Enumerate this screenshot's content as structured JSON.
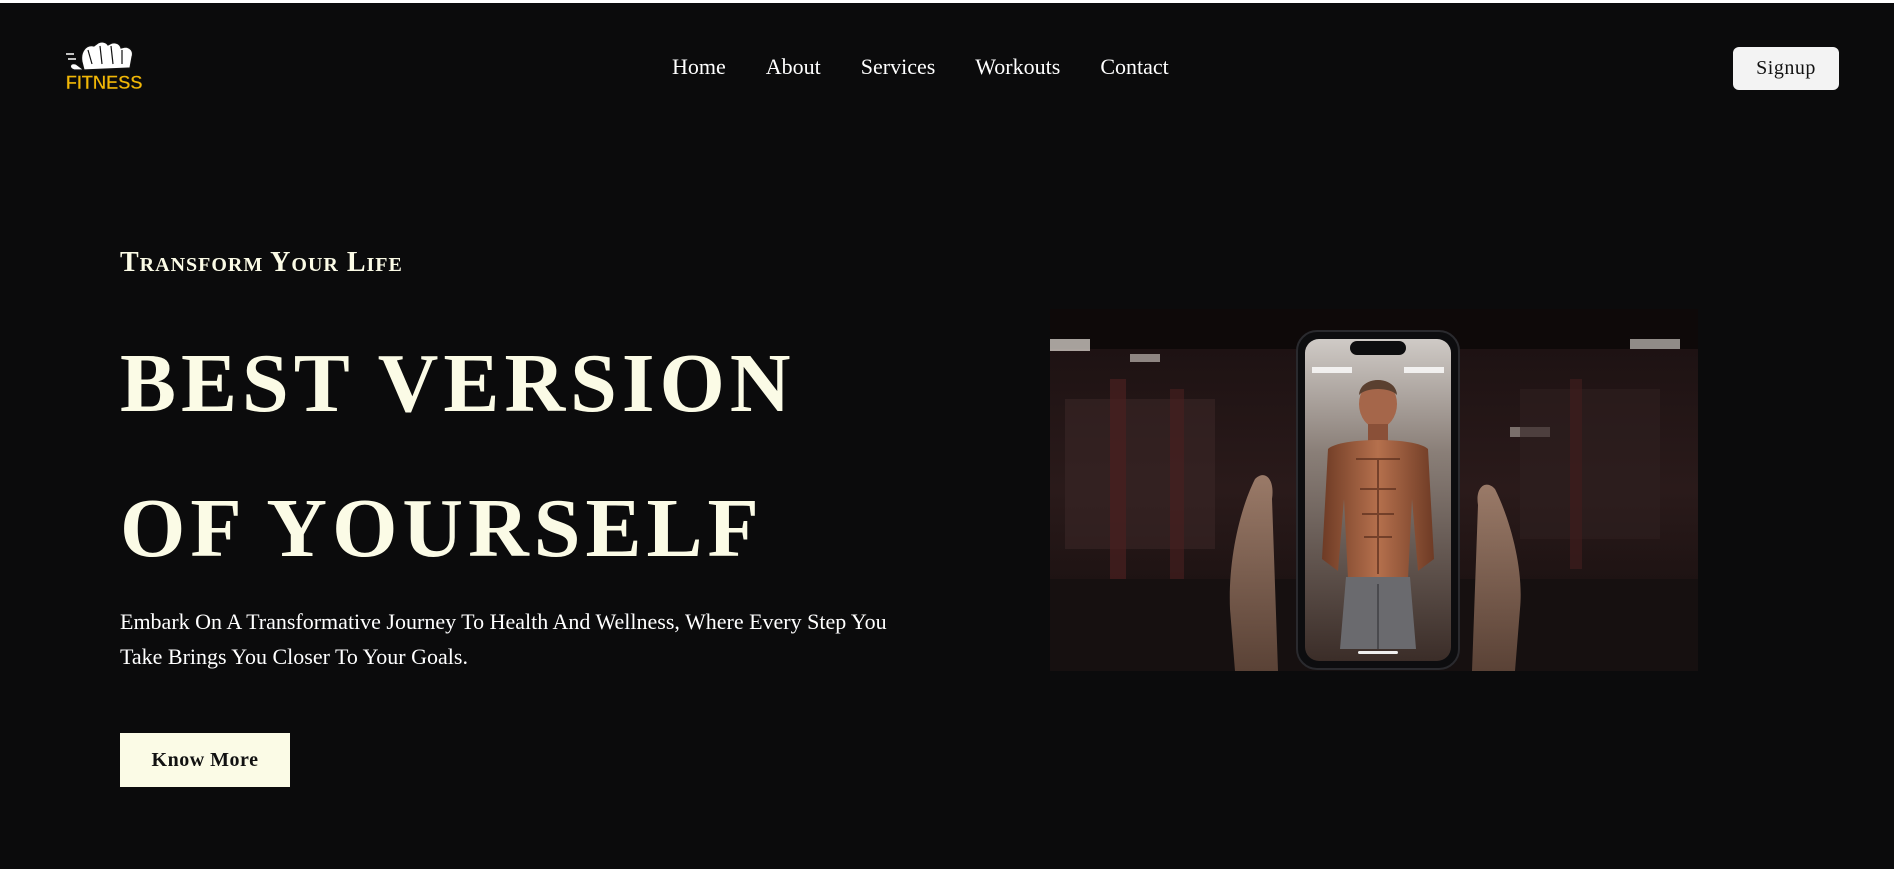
{
  "header": {
    "logo_text": "FITNESS",
    "nav": [
      "Home",
      "About",
      "Services",
      "Workouts",
      "Contact"
    ],
    "signup_label": "Signup"
  },
  "hero": {
    "eyebrow": "Transform Your Life",
    "headline_line1": "BEST VERSION",
    "headline_line2": "OF YOURSELF",
    "description": "Embark On A Transformative Journey To Health And Wellness, Where Every Step You Take Brings You Closer To Your Goals.",
    "cta_label": "Know More",
    "image_icon": "phone-fitness-photo"
  },
  "colors": {
    "background": "#0b0b0c",
    "headline": "#fbfbe6",
    "logo": "#f2b705"
  }
}
